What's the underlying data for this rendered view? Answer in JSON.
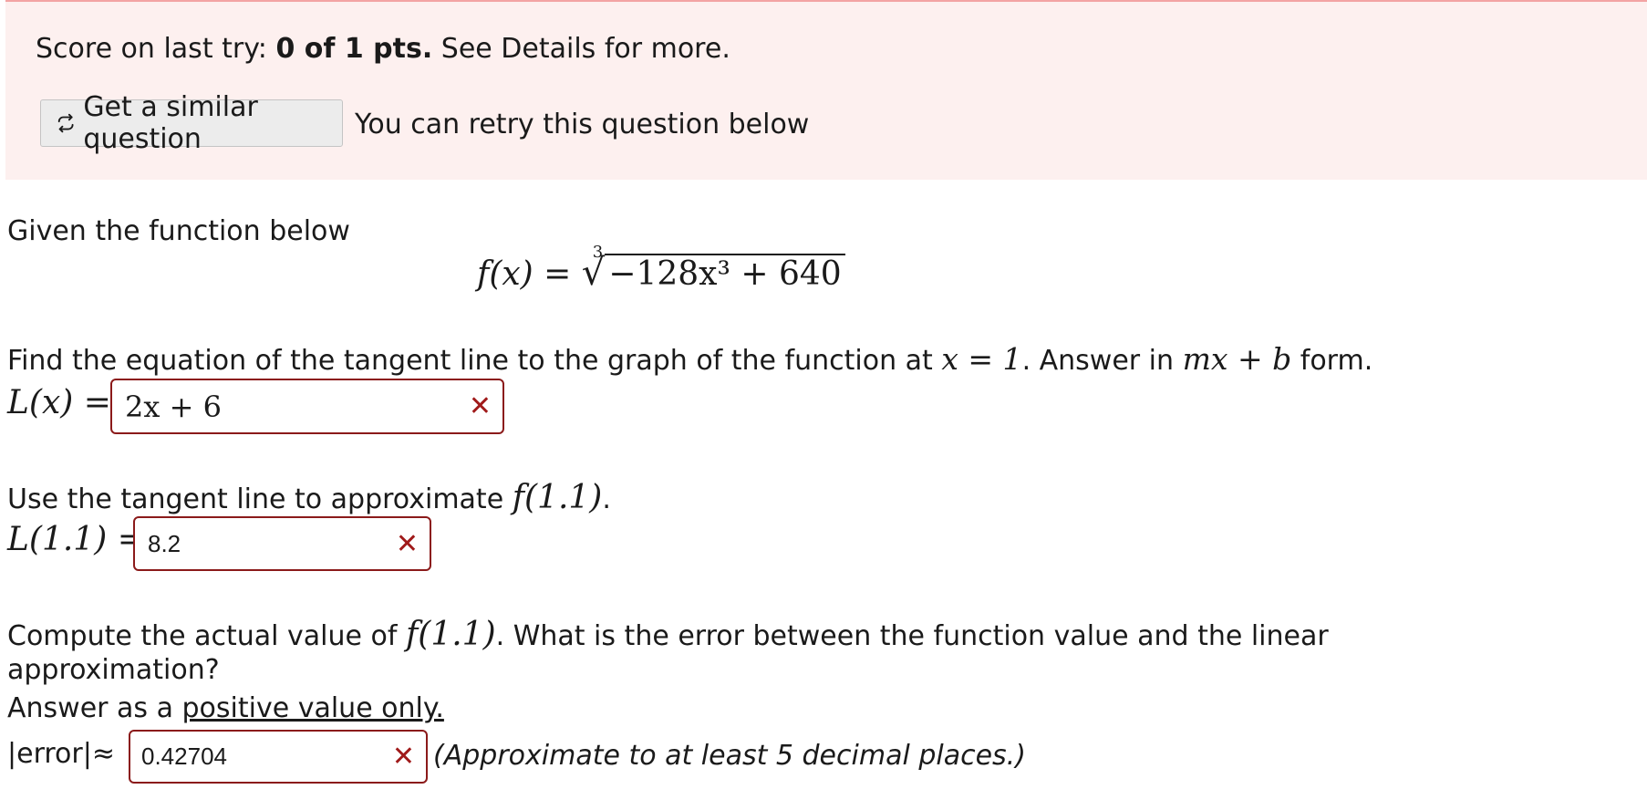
{
  "banner": {
    "score_prefix": "Score on last try: ",
    "score_value": "0 of 1 pts.",
    "score_suffix": " See Details for more.",
    "similar_button_label": "Get a similar question",
    "retry_note": "You can retry this question below"
  },
  "question": {
    "intro": "Given the function below",
    "function": {
      "lhs": "f(x) =",
      "root_index": "3",
      "radicand": "−128x³ + 640"
    },
    "part1": {
      "prompt_a": "Find the equation of the tangent line to the graph of the function at ",
      "prompt_math": "x = 1",
      "prompt_b": ". Answer in ",
      "prompt_form": "mx + b",
      "prompt_c": " form.",
      "lhs": "L(x) =",
      "answer": "2x + 6",
      "mark": "✕"
    },
    "part2": {
      "prompt_a": "Use the tangent line to approximate ",
      "prompt_math": "f(1.1)",
      "prompt_b": ".",
      "lhs": "L(1.1) =",
      "answer": "8.2",
      "mark": "✕"
    },
    "part3": {
      "prompt_a": "Compute the actual value of ",
      "prompt_math": "f(1.1)",
      "prompt_b": ". What is the error between the function value and the linear",
      "prompt_line2": "approximation?",
      "instruction_a": "Answer as a ",
      "instruction_underlined": "positive value only.",
      "lhs": "|error|≈",
      "answer": "0.42704",
      "mark": "✕",
      "hint": "(Approximate to at least 5 decimal places.)"
    }
  },
  "colors": {
    "banner_bg": "#fdf0ef",
    "incorrect": "#8b1a1a"
  }
}
